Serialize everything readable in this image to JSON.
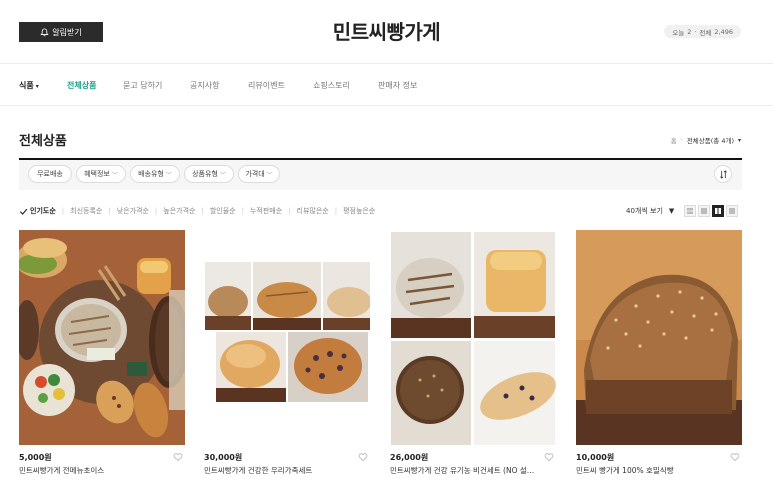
{
  "header": {
    "notify_label": "알림받기",
    "store_title": "민트씨빵가게",
    "visits": {
      "today_label": "오늘",
      "today": "2",
      "total_label": "전체",
      "total": "2,496"
    }
  },
  "nav": {
    "items": [
      {
        "label": "식품"
      },
      {
        "label": "전체상품"
      },
      {
        "label": "묻고 답하기"
      },
      {
        "label": "공지사항"
      },
      {
        "label": "리뷰이벤트"
      },
      {
        "label": "쇼핑스토리"
      },
      {
        "label": "판매자 정보"
      }
    ]
  },
  "section": {
    "title": "전체상품",
    "breadcrumb_home": "홈",
    "breadcrumb_current": "전체상품(총 4개)"
  },
  "filters": {
    "chips": [
      {
        "label": "무료배송"
      },
      {
        "label": "혜택정보"
      },
      {
        "label": "배송유형"
      },
      {
        "label": "상품유형"
      },
      {
        "label": "가격대"
      }
    ]
  },
  "sort": {
    "options": [
      {
        "label": "인기도순"
      },
      {
        "label": "최신등록순"
      },
      {
        "label": "낮은가격순"
      },
      {
        "label": "높은가격순"
      },
      {
        "label": "할인율순"
      },
      {
        "label": "누적판매순"
      },
      {
        "label": "리뷰많은순"
      },
      {
        "label": "평점높은순"
      }
    ],
    "per_page": "40개씩 보기"
  },
  "products": [
    {
      "price": "5,000원",
      "name": "민트씨빵가게 전메뉴초이스"
    },
    {
      "price": "30,000원",
      "name": "민트씨빵가게 건강한 우리가족세트"
    },
    {
      "price": "26,000원",
      "name": "민트씨빵가게 건강 유기농 비건세트 (NO 설탕 버..."
    },
    {
      "price": "10,000원",
      "name": "민트씨 빵가게 100% 호밀식빵"
    }
  ],
  "colors": {
    "accent": "#1aa389",
    "dark": "#2b2b2b"
  }
}
